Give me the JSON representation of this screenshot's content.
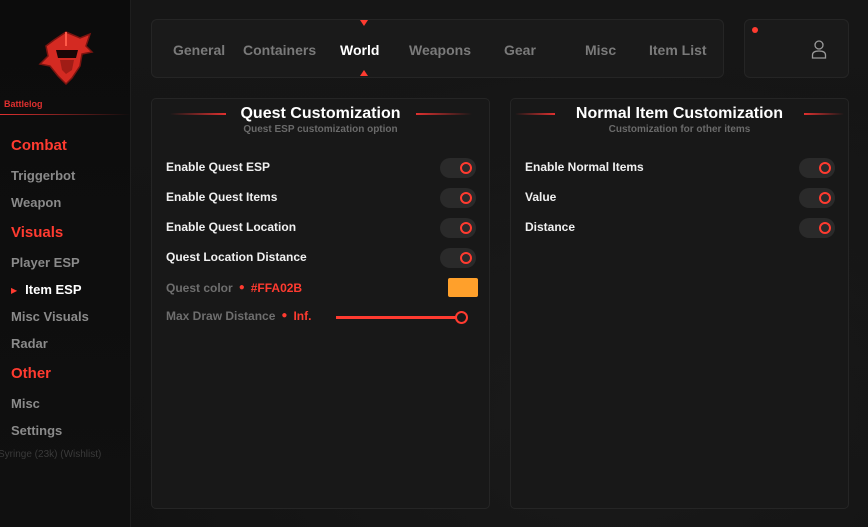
{
  "brand": {
    "name": "Battlelog"
  },
  "sidebar": {
    "sections": [
      {
        "label": "Combat",
        "items": [
          "Triggerbot",
          "Weapon"
        ]
      },
      {
        "label": "Visuals",
        "items": [
          "Player ESP",
          "Item ESP",
          "Misc Visuals",
          "Radar"
        ]
      },
      {
        "label": "Other",
        "items": [
          "Misc",
          "Settings"
        ]
      }
    ],
    "active_item": "Item ESP",
    "background_text": "Syringe (23k) (Wishlist)"
  },
  "tabs": [
    "General",
    "Containers",
    "World",
    "Weapons",
    "Gear",
    "Misc",
    "Item List"
  ],
  "active_tab": "World",
  "quest_panel": {
    "title": "Quest Customization",
    "subtitle": "Quest ESP customization option",
    "toggles": [
      "Enable Quest ESP",
      "Enable Quest Items",
      "Enable Quest Location",
      "Quest Location Distance"
    ],
    "color_label": "Quest color",
    "color_value": "#FFA02B",
    "distance_label": "Max Draw Distance",
    "distance_value": "Inf."
  },
  "normal_panel": {
    "title": "Normal Item Customization",
    "subtitle": "Customization for other items",
    "toggles": [
      "Enable Normal Items",
      "Value",
      "Distance"
    ]
  },
  "colors": {
    "accent": "#FF3B30",
    "swatch": "#FFA02B"
  }
}
